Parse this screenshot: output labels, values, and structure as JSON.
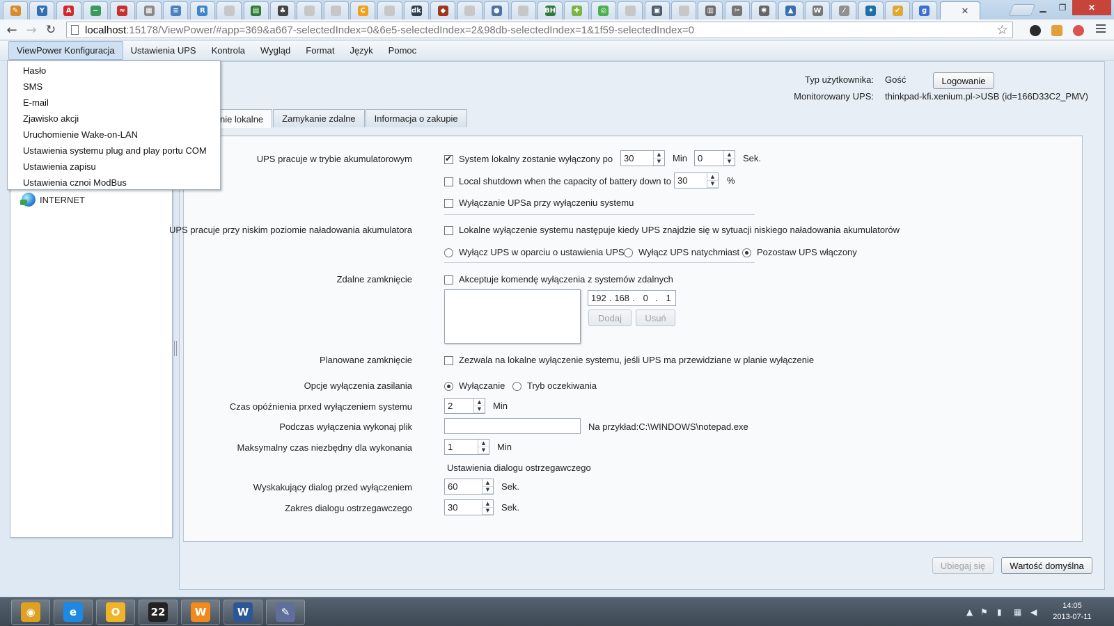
{
  "browser": {
    "tab_favicons": [
      {
        "name": "puzzle-favicon",
        "color": "#d98b2b",
        "glyph": "✎"
      },
      {
        "name": "yammer-favicon",
        "color": "#2f6fb7",
        "glyph": "Y"
      },
      {
        "name": "acrobat-favicon",
        "color": "#d12a2a",
        "glyph": "A"
      },
      {
        "name": "chart-favicon",
        "color": "#3a9a5b",
        "glyph": "~"
      },
      {
        "name": "red-logo-favicon",
        "color": "#c9302c",
        "glyph": "≈"
      },
      {
        "name": "grid-favicon",
        "color": "#8a8a8a",
        "glyph": "▦"
      },
      {
        "name": "doc-favicon",
        "color": "#4a7fc0",
        "glyph": "≡"
      },
      {
        "name": "r-favicon",
        "color": "#3d86cf",
        "glyph": "R"
      },
      {
        "name": "blank-page-favicon",
        "color": "#c7c7c7",
        "glyph": ""
      },
      {
        "name": "film-favicon",
        "color": "#2e7d32",
        "glyph": "▤"
      },
      {
        "name": "clover-favicon",
        "color": "#444444",
        "glyph": "♣"
      },
      {
        "name": "blank-page-favicon",
        "color": "#c7c7c7",
        "glyph": ""
      },
      {
        "name": "blank-page-favicon",
        "color": "#c7c7c7",
        "glyph": ""
      },
      {
        "name": "orange-c-favicon",
        "color": "#f2a01b",
        "glyph": "C"
      },
      {
        "name": "blank-page-favicon",
        "color": "#c7c7c7",
        "glyph": ""
      },
      {
        "name": "dk-favicon",
        "color": "#2d3e50",
        "glyph": "dk"
      },
      {
        "name": "game-favicon",
        "color": "#a0361c",
        "glyph": "◆"
      },
      {
        "name": "blank-page-favicon",
        "color": "#c7c7c7",
        "glyph": ""
      },
      {
        "name": "globe-favicon",
        "color": "#4b73a6",
        "glyph": "●"
      },
      {
        "name": "blank-page-favicon",
        "color": "#c7c7c7",
        "glyph": ""
      },
      {
        "name": "bh-favicon",
        "color": "#2f7a3b",
        "glyph": "BH"
      },
      {
        "name": "android-favicon",
        "color": "#7cb342",
        "glyph": "✚"
      },
      {
        "name": "green-circle-favicon",
        "color": "#4caf50",
        "glyph": "◎"
      },
      {
        "name": "blank-page-favicon",
        "color": "#c7c7c7",
        "glyph": ""
      },
      {
        "name": "news-favicon",
        "color": "#4e5d6c",
        "glyph": "▣"
      },
      {
        "name": "blank-page-favicon",
        "color": "#c7c7c7",
        "glyph": ""
      },
      {
        "name": "building-favicon",
        "color": "#6b6b6b",
        "glyph": "▥"
      },
      {
        "name": "wrench-favicon",
        "color": "#757575",
        "glyph": "✂"
      },
      {
        "name": "settings-favicon",
        "color": "#666666",
        "glyph": "✱"
      },
      {
        "name": "triangle-favicon",
        "color": "#3a6fb0",
        "glyph": "▲"
      },
      {
        "name": "wikipedia-favicon",
        "color": "#777777",
        "glyph": "W"
      },
      {
        "name": "slash-favicon",
        "color": "#909090",
        "glyph": "⁄"
      },
      {
        "name": "fish-favicon",
        "color": "#1f6fa8",
        "glyph": "✦"
      },
      {
        "name": "checkbox-favicon",
        "color": "#e0a82e",
        "glyph": "✔"
      },
      {
        "name": "google-favicon",
        "color": "#3b6ed6",
        "glyph": "g"
      }
    ],
    "active_tab_close": "✕",
    "url_host": "localhost",
    "url_path": ":15178/ViewPower/#app=369&a667-selectedIndex=0&6e5-selectedIndex=2&98db-selectedIndex=1&1f59-selectedIndex=0"
  },
  "menubar": {
    "items": [
      "ViewPower Konfiguracja",
      "Ustawienia UPS",
      "Kontrola",
      "Wygląd",
      "Format",
      "Język",
      "Pomoc"
    ]
  },
  "dropdown": {
    "items": [
      "Hasło",
      "SMS",
      "E-mail",
      "Zjawisko akcji",
      "Uruchomienie Wake-on-LAN",
      "Ustawienia systemu plug and play portu COM",
      "Ustawienia zapisu",
      "Ustawienia cznoi ModBus"
    ]
  },
  "tree": {
    "internet": "INTERNET"
  },
  "header": {
    "user_type_label": "Typ użytkownika:",
    "user_type_value": "Gość",
    "login_button": "Logowanie",
    "ups_label": "Monitorowany UPS:",
    "ups_value": "thinkpad-kfi.xenium.pl->USB (id=166D33C2_PMV)"
  },
  "tabs": [
    "nie lokalne",
    "Zamykanie zdalne",
    "Informacja o zakupie"
  ],
  "form": {
    "battery_mode_label": "UPS pracuje w trybie akumulatorowym",
    "shutdown_after_label": "System lokalny zostanie wyłączony po",
    "shutdown_after_checked": true,
    "shutdown_min": "30",
    "min_unit": "Min",
    "shutdown_sec": "0",
    "sec_unit": "Sek.",
    "capacity_label": "Local shutdown when the capacity of battery down to",
    "capacity_checked": false,
    "capacity_value": "30",
    "percent_unit": "%",
    "ups_off_label": "Wyłączanie UPSa przy wyłączeniu systemu",
    "ups_off_checked": false,
    "low_battery_label": "UPS pracuje przy niskim poziomie naładowania akumulatora",
    "low_battery_option": "Lokalne wyłączenie systemu następuje kiedy UPS znajdzie się w sytuacji niskiego naładowania akumulatorów",
    "low_battery_checked": false,
    "radio_off_settings": "Wyłącz UPS w oparciu o ustawienia UPS",
    "radio_off_now": "Wyłącz UPS natychmiast",
    "radio_keep_on": "Pozostaw UPS włączony",
    "radio_selected": "keep_on",
    "remote_label": "Zdalne zamknięcie",
    "remote_option": "Akceptuje komendę wyłączenia z systemów zdalnych",
    "remote_checked": false,
    "ip": [
      "192",
      "168",
      "0",
      "1"
    ],
    "add_button": "Dodaj",
    "remove_button": "Usuń",
    "planned_label": "Planowane zamknięcie",
    "planned_option": "Zezwala na lokalne wyłączenie systemu, jeśli UPS ma przewidziane w planie wyłączenie",
    "planned_checked": false,
    "power_off_label": "Opcje wyłączenia zasilania",
    "power_off_shutdown": "Wyłączanie",
    "power_off_standby": "Tryb oczekiwania",
    "power_off_selected": "shutdown",
    "delay_label": "Czas opóźnienia prxed wyłączeniem systemu",
    "delay_value": "2",
    "delay_unit": "Min",
    "run_file_label": "Podczas wyłączenia wykonaj plik",
    "run_file_value": "",
    "run_file_example": "Na przykład:C:\\WINDOWS\\notepad.exe",
    "max_time_label": "Maksymalny czas niezbędny dla wykonania",
    "max_time_value": "1",
    "max_time_unit": "Min",
    "warning_section": "Ustawienia dialogu ostrzegawczego",
    "popup_label": "Wyskakujący dialog przed wyłączeniem",
    "popup_value": "60",
    "popup_unit": "Sek.",
    "interval_label": "Zakres dialogu ostrzegawczego",
    "interval_value": "30",
    "interval_unit": "Sek."
  },
  "footer": {
    "apply_button": "Ubiegaj się",
    "default_button": "Wartość domyślna"
  },
  "taskbar": {
    "apps": [
      {
        "name": "chrome-taskbar-icon",
        "color": "#e0a020",
        "glyph": "◉"
      },
      {
        "name": "ie-taskbar-icon",
        "color": "#1e88e5",
        "glyph": "e"
      },
      {
        "name": "outlook-taskbar-icon",
        "color": "#f0b429",
        "glyph": "O"
      },
      {
        "name": "poker-taskbar-icon",
        "color": "#222222",
        "glyph": "22"
      },
      {
        "name": "cloud-taskbar-icon",
        "color": "#f08a1c",
        "glyph": "W"
      },
      {
        "name": "word-taskbar-icon",
        "color": "#2b5797",
        "glyph": "W"
      },
      {
        "name": "tool-taskbar-icon",
        "color": "#5f6f9a",
        "glyph": "✎"
      }
    ],
    "time": "14:05",
    "date": "2013-07-11"
  }
}
